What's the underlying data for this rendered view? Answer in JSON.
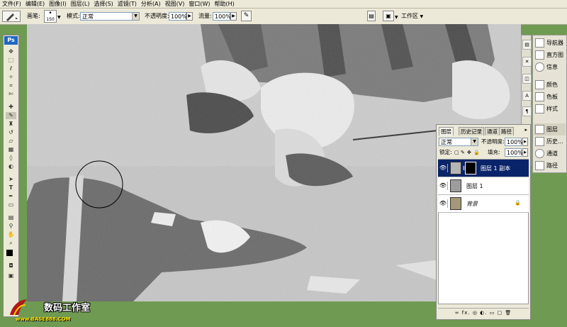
{
  "menu": [
    "文件(F)",
    "编辑(E)",
    "图像(I)",
    "图层(L)",
    "选择(S)",
    "滤镜(T)",
    "分析(A)",
    "视图(V)",
    "窗口(W)",
    "帮助(H)"
  ],
  "options": {
    "brush_label": "画笔:",
    "brush_size": "150",
    "mode_label": "模式:",
    "mode_value": "正常",
    "opacity_label": "不透明度:",
    "opacity_value": "100%",
    "flow_label": "流量:",
    "flow_value": "100%",
    "workspace_label": "工作区"
  },
  "toolbox": {
    "logo": "Ps",
    "tools": [
      "move-icon",
      "marquee-icon",
      "lasso-icon",
      "magic-wand-icon",
      "crop-icon",
      "slice-icon",
      "heal-icon",
      "brush-icon",
      "stamp-icon",
      "history-brush-icon",
      "eraser-icon",
      "gradient-icon",
      "blur-icon",
      "dodge-icon",
      "path-select-icon",
      "type-icon",
      "pen-icon",
      "shape-icon",
      "notes-icon",
      "eyedropper-icon",
      "hand-icon",
      "zoom-icon"
    ]
  },
  "right_dock": {
    "items": [
      {
        "label": "导航器",
        "icon": "navigator-icon"
      },
      {
        "label": "直方图",
        "icon": "histogram-icon"
      },
      {
        "label": "信息",
        "icon": "info-icon"
      },
      {
        "label": "颜色",
        "icon": "color-icon"
      },
      {
        "label": "色板",
        "icon": "swatches-icon"
      },
      {
        "label": "样式",
        "icon": "styles-icon"
      },
      {
        "label": "图层",
        "icon": "layers-icon"
      },
      {
        "label": "历史...",
        "icon": "history-icon"
      },
      {
        "label": "通道",
        "icon": "channels-icon"
      },
      {
        "label": "路径",
        "icon": "paths-icon"
      }
    ]
  },
  "layers_panel": {
    "tabs": [
      "图层",
      "历史记录",
      "通道",
      "路径"
    ],
    "blend_mode": "正常",
    "opacity_label": "不透明度:",
    "opacity_value": "100%",
    "lock_label": "锁定:",
    "fill_label": "填充:",
    "fill_value": "100%",
    "layers": [
      {
        "name": "图层 1 副本",
        "selected": true
      },
      {
        "name": "图层 1",
        "selected": false
      },
      {
        "name": "背景",
        "selected": false
      }
    ],
    "footer": "∞ fx. ◎ ◐. ▭ ▢ 🗑"
  },
  "watermark": {
    "title": "数码工作室",
    "url": "www.BASE888.COM"
  }
}
